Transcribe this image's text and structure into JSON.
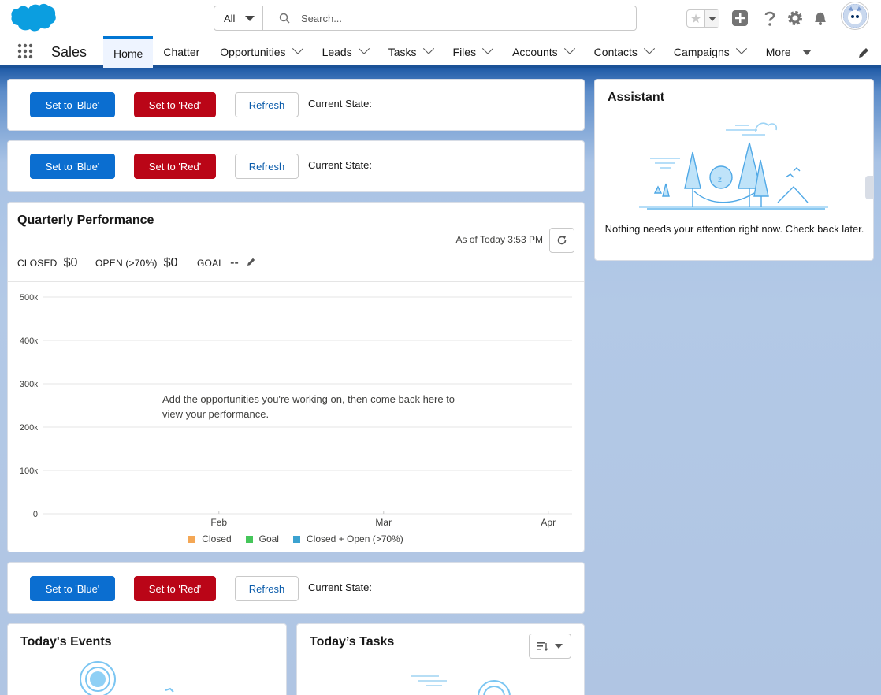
{
  "header": {
    "search_scope": "All",
    "search_placeholder": "Search..."
  },
  "nav": {
    "app_name": "Sales",
    "items": [
      {
        "label": "Home",
        "active": true,
        "menu": "none"
      },
      {
        "label": "Chatter",
        "active": false,
        "menu": "none"
      },
      {
        "label": "Opportunities",
        "active": false,
        "menu": "chevron"
      },
      {
        "label": "Leads",
        "active": false,
        "menu": "chevron"
      },
      {
        "label": "Tasks",
        "active": false,
        "menu": "chevron"
      },
      {
        "label": "Files",
        "active": false,
        "menu": "chevron"
      },
      {
        "label": "Accounts",
        "active": false,
        "menu": "chevron"
      },
      {
        "label": "Contacts",
        "active": false,
        "menu": "chevron"
      },
      {
        "label": "Campaigns",
        "active": false,
        "menu": "chevron"
      },
      {
        "label": "More",
        "active": false,
        "menu": "triangle"
      }
    ]
  },
  "state_cards": [
    {
      "blue_label": "Set to 'Blue'",
      "red_label": "Set to 'Red'",
      "refresh_label": "Refresh",
      "state_label": "Current State:"
    },
    {
      "blue_label": "Set to 'Blue'",
      "red_label": "Set to 'Red'",
      "refresh_label": "Refresh",
      "state_label": "Current State:"
    },
    {
      "blue_label": "Set to 'Blue'",
      "red_label": "Set to 'Red'",
      "refresh_label": "Refresh",
      "state_label": "Current State:"
    }
  ],
  "performance": {
    "title": "Quarterly Performance",
    "as_of": "As of Today 3:53 PM",
    "closed_label": "CLOSED",
    "closed_value": "$0",
    "open_label": "OPEN (>70%)",
    "open_value": "$0",
    "goal_label": "GOAL",
    "goal_value": "--",
    "empty_message": "Add the opportunities you're working on, then come back here to view your performance."
  },
  "chart_data": {
    "type": "line",
    "title": "",
    "xlabel": "",
    "ylabel": "",
    "x_ticks": [
      "Feb",
      "Mar",
      "Apr"
    ],
    "y_ticks": [
      "0",
      "100к",
      "200к",
      "300к",
      "400к",
      "500к"
    ],
    "ylim": [
      0,
      500000
    ],
    "grid": true,
    "legend_position": "bottom",
    "series": [
      {
        "name": "Closed",
        "color": "#f4a755",
        "values": []
      },
      {
        "name": "Goal",
        "color": "#45c65a",
        "values": []
      },
      {
        "name": "Closed + Open (>70%)",
        "color": "#3ba2d0",
        "values": []
      }
    ]
  },
  "assistant": {
    "title": "Assistant",
    "message": "Nothing needs your attention right now. Check back later."
  },
  "events": {
    "title": "Today's Events"
  },
  "tasks": {
    "title": "Today’s Tasks"
  },
  "colors": {
    "brand_blue": "#0b6ed0",
    "brand_red": "#ba0517",
    "nav_accent": "#1b5297"
  }
}
